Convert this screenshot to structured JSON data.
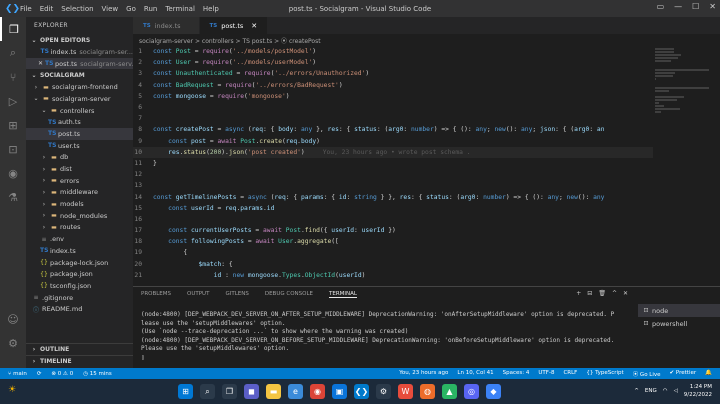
{
  "window": {
    "title": "post.ts - Socialgram - Visual Studio Code",
    "menu": [
      "File",
      "Edit",
      "Selection",
      "View",
      "Go",
      "Run",
      "Terminal",
      "Help"
    ]
  },
  "sidebar": {
    "header": "EXPLORER",
    "open_editors_label": "OPEN EDITORS",
    "open_editors": [
      {
        "name": "index.ts",
        "path": "socialgram-ser..."
      },
      {
        "name": "post.ts",
        "path": "socialgram-serv..."
      }
    ],
    "workspace_label": "SOCIALGRAM",
    "tree": [
      {
        "label": "socialgram-frontend",
        "depth": 0,
        "kind": "folder"
      },
      {
        "label": "socialgram-server",
        "depth": 0,
        "kind": "folder-open"
      },
      {
        "label": "controllers",
        "depth": 1,
        "kind": "folder-open"
      },
      {
        "label": "auth.ts",
        "depth": 2,
        "kind": "ts"
      },
      {
        "label": "post.ts",
        "depth": 2,
        "kind": "ts",
        "selected": true
      },
      {
        "label": "user.ts",
        "depth": 2,
        "kind": "ts"
      },
      {
        "label": "db",
        "depth": 1,
        "kind": "folder"
      },
      {
        "label": "dist",
        "depth": 1,
        "kind": "folder"
      },
      {
        "label": "errors",
        "depth": 1,
        "kind": "folder"
      },
      {
        "label": "middleware",
        "depth": 1,
        "kind": "folder"
      },
      {
        "label": "models",
        "depth": 1,
        "kind": "folder"
      },
      {
        "label": "node_modules",
        "depth": 1,
        "kind": "folder"
      },
      {
        "label": "routes",
        "depth": 1,
        "kind": "folder"
      },
      {
        "label": ".env",
        "depth": 1,
        "kind": "file"
      },
      {
        "label": "index.ts",
        "depth": 1,
        "kind": "ts"
      },
      {
        "label": "package-lock.json",
        "depth": 1,
        "kind": "json"
      },
      {
        "label": "package.json",
        "depth": 1,
        "kind": "json"
      },
      {
        "label": "tsconfig.json",
        "depth": 1,
        "kind": "json"
      },
      {
        "label": ".gitignore",
        "depth": 0,
        "kind": "file"
      },
      {
        "label": "README.md",
        "depth": 0,
        "kind": "md"
      }
    ],
    "outline_label": "OUTLINE",
    "timeline_label": "TIMELINE"
  },
  "tabs": [
    {
      "label": "index.ts",
      "active": false
    },
    {
      "label": "post.ts",
      "active": true
    }
  ],
  "breadcrumb": "socialgram-server > controllers > TS post.ts > ⦿ createPost",
  "editor": {
    "lines": [
      {
        "n": "1",
        "t": "const Post = require('../models/postModel')"
      },
      {
        "n": "2",
        "t": "const User = require('../models/userModel')"
      },
      {
        "n": "3",
        "t": "const Unauthenticated = require('../errors/Unauthorized')"
      },
      {
        "n": "4",
        "t": "const BadRequest = require('../errors/BadRequest')"
      },
      {
        "n": "5",
        "t": "const mongoose = require('mongoose')"
      },
      {
        "n": "6",
        "t": ""
      },
      {
        "n": "7",
        "t": ""
      },
      {
        "n": "8",
        "t": "const createPost = async (req: { body: any }, res: { status: (arg0: number) => { (): any; new(): any; json: { (arg0: an"
      },
      {
        "n": "9",
        "t": "    const post = await Post.create(req.body)"
      },
      {
        "n": "10",
        "t": "    res.status(200).json('post created')",
        "current": true,
        "ghost": "You, 23 hours ago • wrote post schema ."
      },
      {
        "n": "11",
        "t": "}"
      },
      {
        "n": "12",
        "t": ""
      },
      {
        "n": "13",
        "t": ""
      },
      {
        "n": "14",
        "t": "const getTimelinePosts = async (req: { params: { id: string } }, res: { status: (arg0: number) => { (): any; new(): any"
      },
      {
        "n": "15",
        "t": "    const userId = req.params.id"
      },
      {
        "n": "16",
        "t": ""
      },
      {
        "n": "17",
        "t": "    const currentUserPosts = await Post.find({ userId: userId })"
      },
      {
        "n": "18",
        "t": "    const followingPosts = await User.aggregate(["
      },
      {
        "n": "19",
        "t": "        {"
      },
      {
        "n": "20",
        "t": "            $match: {"
      },
      {
        "n": "21",
        "t": "                id : new mongoose.Types.ObjectId(userId)"
      },
      {
        "n": "22",
        "t": "            }"
      }
    ]
  },
  "panel": {
    "tabs": [
      "PROBLEMS",
      "OUTPUT",
      "GITLENS",
      "DEBUG CONSOLE",
      "TERMINAL"
    ],
    "active_tab": "TERMINAL",
    "terminal_lines": [
      "(node:4800) [DEP_WEBPACK_DEV_SERVER_ON_AFTER_SETUP_MIDDLEWARE] DeprecationWarning: 'onAfterSetupMiddleware' option is deprecated. P",
      "lease use the 'setupMiddlewares' option.",
      "(Use `node --trace-deprecation ...` to show where the warning was created)",
      "(node:4800) [DEP_WEBPACK_DEV_SERVER_ON_BEFORE_SETUP_MIDDLEWARE] DeprecationWarning: 'onBeforeSetupMiddleware' option is deprecated.",
      " Please use the 'setupMiddlewares' option.",
      "▯"
    ],
    "terminals": [
      "node",
      "powershell"
    ]
  },
  "status": {
    "branch": "main",
    "sync": "⟳",
    "problems": "⊗ 0 ⚠ 0",
    "time": "◷ 15 mins",
    "blame": "You, 23 hours ago",
    "cursor": "Ln 10, Col 41",
    "spaces": "Spaces: 4",
    "encoding": "UTF-8",
    "eol": "CRLF",
    "lang": "{} TypeScript",
    "golive": "⦿ Go Live",
    "prettier": "✔ Prettier"
  },
  "taskbar": {
    "time": "1:24 PM",
    "date": "9/22/2022",
    "lang": "ENG"
  }
}
